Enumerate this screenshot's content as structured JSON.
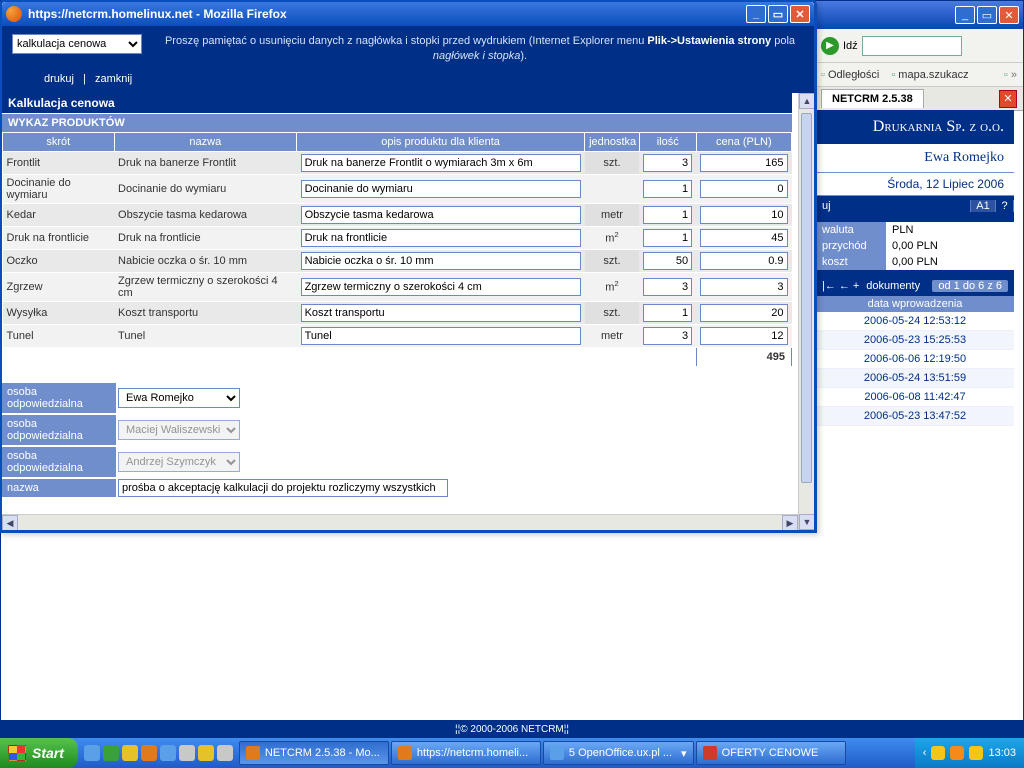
{
  "ie": {
    "go_label": "Idź",
    "bookmarks": [
      "Odległości",
      "mapa.szukacz"
    ],
    "tab": "NETCRM 2.5.38"
  },
  "crm_right": {
    "company": "Drukarnia Sp. z o.o.",
    "user": "Ewa Romejko",
    "date": "Środa, 12 Lipiec 2006",
    "uj": "uj",
    "a1": "A1",
    "q": "?",
    "kv": [
      {
        "k": "waluta",
        "v": "PLN"
      },
      {
        "k": "przychód",
        "v": "0,00 PLN"
      },
      {
        "k": "koszt",
        "v": "0,00 PLN"
      }
    ],
    "docs_label": "dokumenty",
    "docs_range": "od 1 do 6 z 6",
    "docs_th": "data wprowadzenia",
    "docs": [
      "2006-05-24 12:53:12",
      "2006-05-23 15:25:53",
      "2006-06-06 12:19:50",
      "2006-05-24 13:51:59",
      "2006-06-08 11:42:47",
      "2006-05-23 13:47:52"
    ]
  },
  "ff": {
    "title": "https://netcrm.homelinux.net - Mozilla Firefox",
    "selector": "kalkulacja cenowa",
    "hint_pre": "Proszę pamiętać o usunięciu danych z nagłówka i stopki przed wydrukiem (Internet Explorer menu ",
    "hint_b1": "Plik->Ustawienia strony",
    "hint_mid": " pola ",
    "hint_i": "nagłówek i stopka",
    "hint_post": ").",
    "links": {
      "print": "drukuj",
      "close": "zamknij"
    },
    "section": "Kalkulacja cenowa",
    "sub": "WYKAZ PRODUKTÓW",
    "th": {
      "skrot": "skrót",
      "nazwa": "nazwa",
      "opis": "opis produktu dla klienta",
      "jedn": "jednostka",
      "ilosc": "ilość",
      "cena": "cena (PLN)"
    },
    "rows": [
      {
        "s": "Frontlit",
        "n": "Druk na banerze Frontlit",
        "o": "Druk na banerze Frontlit o wymiarach 3m x 6m",
        "j": "szt.",
        "i": "3",
        "c": "165"
      },
      {
        "s": "Docinanie do wymiaru",
        "n": "Docinanie do wymiaru",
        "o": "Docinanie do wymiaru",
        "j": "",
        "i": "1",
        "c": "0"
      },
      {
        "s": "Kedar",
        "n": "Obszycie tasma kedarowa",
        "o": "Obszycie tasma kedarowa",
        "j": "metr",
        "i": "1",
        "c": "10"
      },
      {
        "s": "Druk na frontlicie",
        "n": "Druk na frontlicie",
        "o": "Druk na frontlicie",
        "j": "m²",
        "i": "1",
        "c": "45"
      },
      {
        "s": "Oczko",
        "n": "Nabicie oczka o śr. 10 mm",
        "o": "Nabicie oczka o śr. 10 mm",
        "j": "szt.",
        "i": "50",
        "c": "0.9"
      },
      {
        "s": "Zgrzew",
        "n": "Zgrzew termiczny o szerokości 4 cm",
        "o": "Zgrzew termiczny o szerokości 4 cm",
        "j": "m²",
        "i": "3",
        "c": "3"
      },
      {
        "s": "Wysyłka",
        "n": "Koszt transportu",
        "o": "Koszt transportu",
        "j": "szt.",
        "i": "1",
        "c": "20"
      },
      {
        "s": "Tunel",
        "n": "Tunel",
        "o": "Tunel",
        "j": "metr",
        "i": "3",
        "c": "12"
      }
    ],
    "total": "495",
    "resp_label": "osoba odpowiedzialna",
    "name_label": "nazwa",
    "resp": [
      {
        "v": "Ewa Romejko",
        "en": true
      },
      {
        "v": "Maciej Waliszewski",
        "en": false
      },
      {
        "v": "Andrzej Szymczyk",
        "en": false
      }
    ],
    "name_val": "prośba o akceptację kalkulacji do projektu rozliczymy wszystkich"
  },
  "footer": "© 2000-2006 NETCRM",
  "taskbar": {
    "start": "Start",
    "items": [
      {
        "t": "NETCRM 2.5.38 - Mo...",
        "c": "#e07a1a",
        "a": true
      },
      {
        "t": "https://netcrm.homeli...",
        "c": "#e07a1a",
        "a": false
      },
      {
        "t": "5 OpenOffice.ux.pl ...",
        "c": "#5aa0e8",
        "a": false,
        "drop": true
      },
      {
        "t": "OFERTY CENOWE",
        "c": "#d03a2a",
        "a": false
      }
    ],
    "clock": "13:03"
  }
}
